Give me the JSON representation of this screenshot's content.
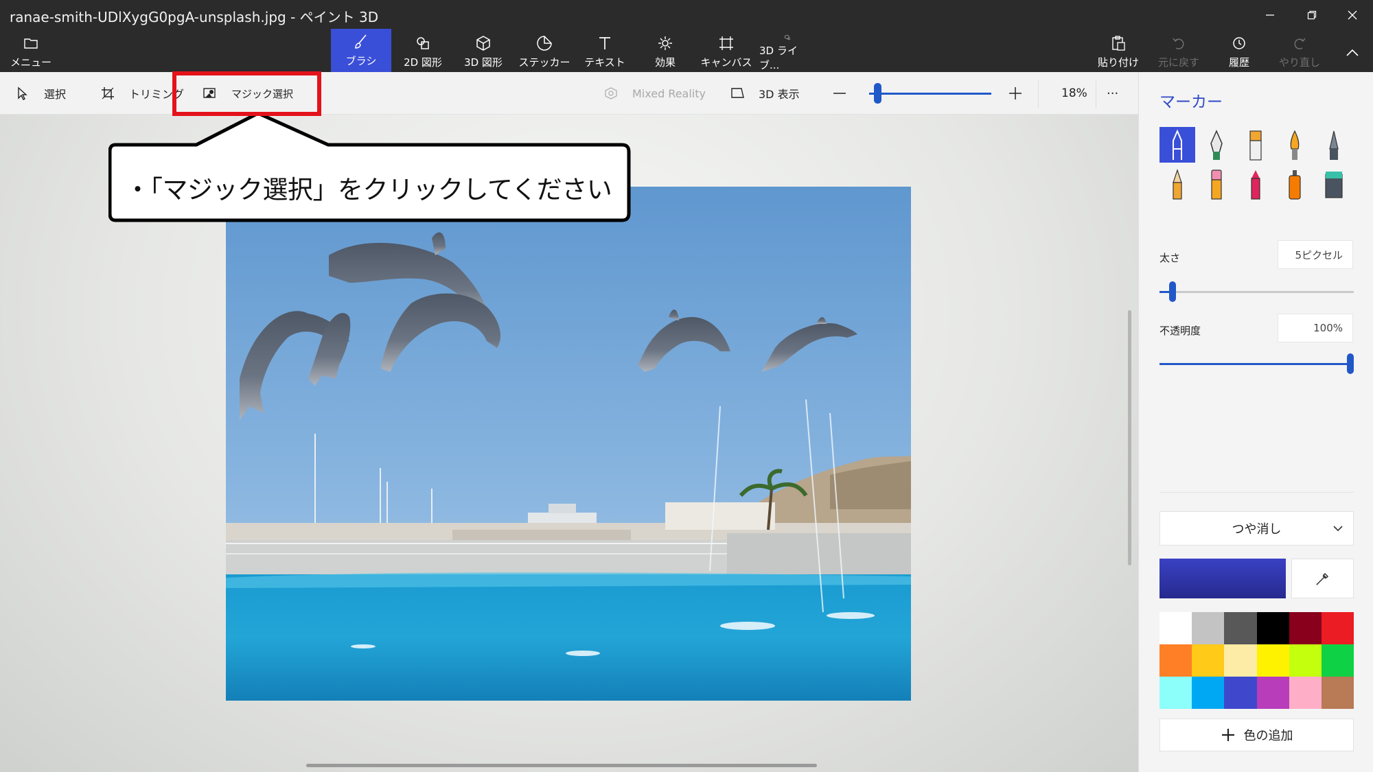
{
  "window": {
    "title": "ranae-smith-UDlXygG0pgA-unsplash.jpg - ペイント 3D"
  },
  "ribbon": {
    "menu": "メニュー",
    "tabs": [
      {
        "label": "ブラシ",
        "icon": "brush-icon",
        "active": true
      },
      {
        "label": "2D 図形",
        "icon": "2d-shapes-icon"
      },
      {
        "label": "3D 図形",
        "icon": "3d-shapes-icon"
      },
      {
        "label": "ステッカー",
        "icon": "sticker-icon"
      },
      {
        "label": "テキスト",
        "icon": "text-icon"
      },
      {
        "label": "効果",
        "icon": "effects-icon"
      },
      {
        "label": "キャンバス",
        "icon": "canvas-icon"
      },
      {
        "label": "3D ライブ...",
        "icon": "3d-library-icon"
      }
    ],
    "right": [
      {
        "label": "貼り付け",
        "icon": "paste-icon"
      },
      {
        "label": "元に戻す",
        "icon": "undo-icon",
        "disabled": true
      },
      {
        "label": "履歴",
        "icon": "history-icon"
      },
      {
        "label": "やり直し",
        "icon": "redo-icon",
        "disabled": true
      }
    ]
  },
  "toolbar": {
    "select": "選択",
    "crop": "トリミング",
    "magic_select": "マジック選択",
    "mixed_reality": "Mixed Reality",
    "view_3d": "3D 表示",
    "zoom": "18%",
    "zoom_level": 0.04,
    "more": "···"
  },
  "callout": {
    "text": "・「マジック選択」をクリックしてください"
  },
  "panel": {
    "title": "マーカー",
    "brushes": [
      "marker-icon",
      "calligraphy-pen-icon",
      "oil-brush-icon",
      "watercolor-icon",
      "pixel-pen-icon",
      "pencil-icon",
      "eraser-icon",
      "crayon-icon",
      "spray-can-icon",
      "fill-icon"
    ],
    "thickness_label": "太さ",
    "thickness_value": "5ピクセル",
    "thickness_level": 0.05,
    "opacity_label": "不透明度",
    "opacity_value": "100%",
    "opacity_level": 1.0,
    "finish": "つや消し",
    "current_color": "#3a41c4",
    "palette": [
      "#ffffff",
      "#c3c3c3",
      "#585858",
      "#000000",
      "#88001b",
      "#ec1c24",
      "#ff7f27",
      "#ffca18",
      "#fdeca6",
      "#fff200",
      "#c4ff0e",
      "#0ed145",
      "#8cfffb",
      "#00a8f3",
      "#3f48cc",
      "#b83dba",
      "#ffaec8",
      "#b97a56"
    ],
    "add_color": "色の追加"
  },
  "colors": {
    "accent": "#3a4fd8",
    "highlight": "#e4121b"
  }
}
